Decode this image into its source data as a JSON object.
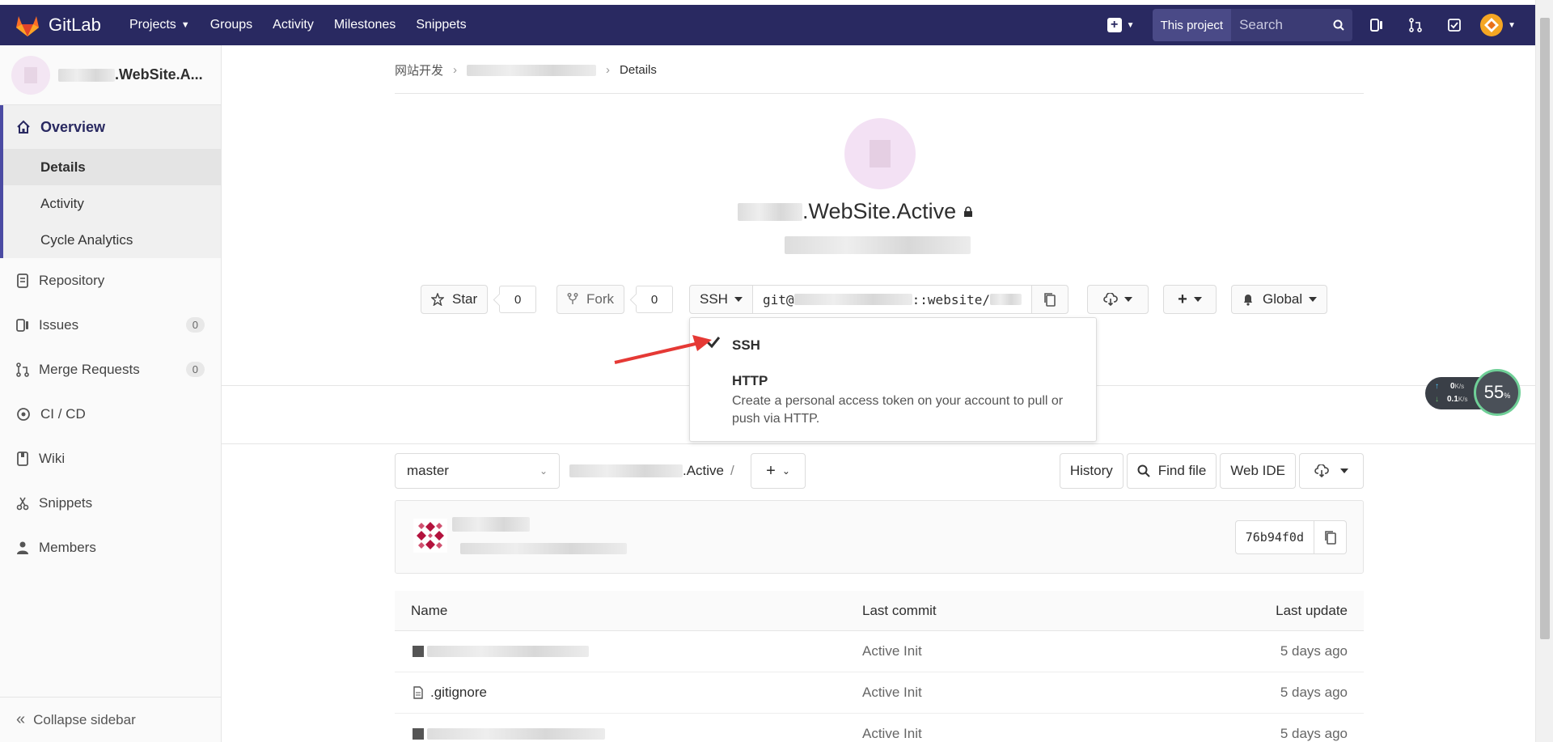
{
  "navbar": {
    "brand": "GitLab",
    "links": [
      "Projects",
      "Groups",
      "Activity",
      "Milestones",
      "Snippets"
    ],
    "search_scope": "This project",
    "search_placeholder": "Search"
  },
  "sidebar": {
    "project_name_suffix": ".WebSite.A...",
    "overview": "Overview",
    "overview_items": [
      "Details",
      "Activity",
      "Cycle Analytics"
    ],
    "items": [
      {
        "label": "Repository",
        "icon": "repository-icon"
      },
      {
        "label": "Issues",
        "icon": "issues-icon",
        "badge": "0"
      },
      {
        "label": "Merge Requests",
        "icon": "merge-request-icon",
        "badge": "0"
      },
      {
        "label": "CI / CD",
        "icon": "ci-cd-icon"
      },
      {
        "label": "Wiki",
        "icon": "wiki-icon"
      },
      {
        "label": "Snippets",
        "icon": "snippets-icon"
      },
      {
        "label": "Members",
        "icon": "members-icon"
      }
    ],
    "collapse": "Collapse sidebar"
  },
  "breadcrumb": {
    "group": "网站开发",
    "current": "Details"
  },
  "project": {
    "title_suffix": ".WebSite.Active"
  },
  "actions": {
    "star": "Star",
    "star_count": "0",
    "fork": "Fork",
    "fork_count": "0",
    "clone_protocol": "SSH",
    "clone_url_prefix": "git@",
    "clone_url_mid": "::website/",
    "notification": "Global"
  },
  "clone_dropdown": {
    "ssh_label": "SSH",
    "http_label": "HTTP",
    "http_desc": "Create a personal access token on your account to pull or push via HTTP."
  },
  "tree": {
    "branch": "master",
    "path_suffix": ".Active",
    "path_sep": "/",
    "history": "History",
    "find_file": "Find file",
    "web_ide": "Web IDE"
  },
  "commit": {
    "sha": "76b94f0d"
  },
  "files": {
    "headers": [
      "Name",
      "Last commit",
      "Last update"
    ],
    "rows": [
      {
        "name": "",
        "type": "folder",
        "commit": "Active Init",
        "updated": "5 days ago"
      },
      {
        "name": ".gitignore",
        "type": "file",
        "commit": "Active Init",
        "updated": "5 days ago"
      },
      {
        "name": "",
        "type": "folder",
        "commit": "Active Init",
        "updated": "5 days ago"
      }
    ]
  },
  "speed_widget": {
    "up": "0",
    "up_unit": "K/s",
    "down": "0.1",
    "down_unit": "K/s",
    "percent": "55",
    "percent_unit": "%"
  },
  "colors": {
    "navbar": "#292961",
    "accent": "#4b4ba3",
    "annotation_arrow": "#e53935"
  }
}
